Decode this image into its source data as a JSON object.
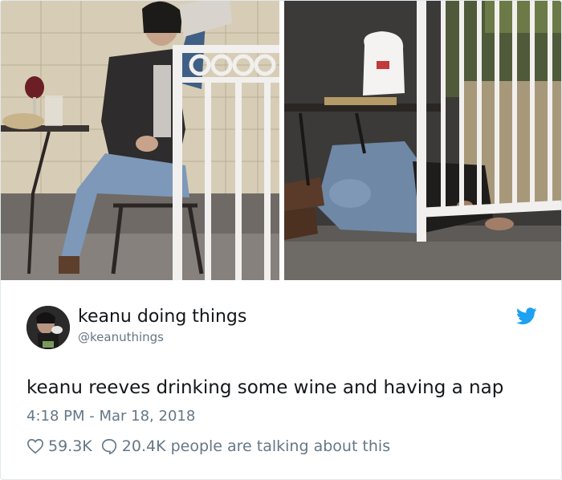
{
  "tweet": {
    "display_name": "keanu doing things",
    "handle": "@keanuthings",
    "text": "keanu reeves drinking some wine and having a nap",
    "timestamp": "4:18 PM - Mar 18, 2018",
    "likes": "59.3K",
    "talking": "20.4K people are talking about this"
  },
  "icons": {
    "brand": "twitter-bird-icon",
    "like": "heart-icon",
    "reply": "speech-bubble-icon"
  },
  "colors": {
    "twitter_blue": "#1da1f2",
    "text_primary": "#14171a",
    "text_secondary": "#657786",
    "border": "#e1e8ed"
  }
}
